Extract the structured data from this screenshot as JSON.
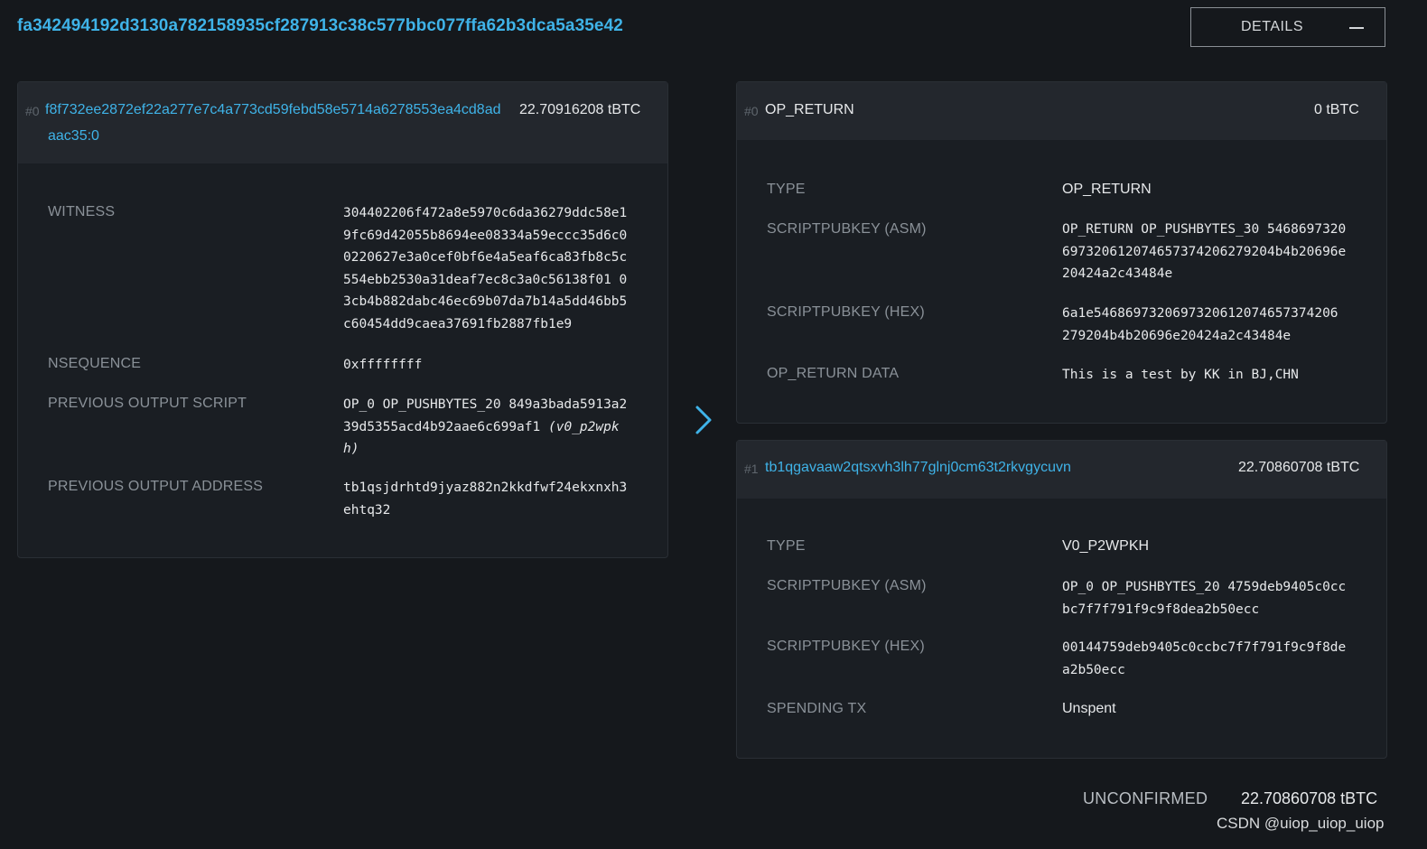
{
  "tx": {
    "txid": "fa342494192d3130a782158935cf287913c38c577bbc077ffa62b3dca5a35e42",
    "details_label": "DETAILS"
  },
  "inputs": [
    {
      "index": "#0",
      "prev_out_line1": "f8f732ee2872ef22a277e7c4a773cd59febd58e5714a6278553ea4cd8ad",
      "prev_out_line2": "aac35:0",
      "amount": "22.70916208 tBTC",
      "fields": {
        "witness_label": "WITNESS",
        "witness_lines": [
          "304402206f472a8e5970c6da36279ddc58e1",
          "9fc69d42055b8694ee08334a59eccc35d6c0",
          "0220627e3a0cef0bf6e4a5eaf6ca83fb8c5c",
          "554ebb2530a31deaf7ec8c3a0c56138f01 0",
          "3cb4b882dabc46ec69b07da7b14a5dd46bb5",
          "c60454dd9caea37691fb2887fb1e9"
        ],
        "nsequence_label": "NSEQUENCE",
        "nsequence": "0xffffffff",
        "prev_script_label": "PREVIOUS OUTPUT SCRIPT",
        "prev_script_line1": "OP_0 OP_PUSHBYTES_20 849a3bada5913a2",
        "prev_script_line2": "39d5355acd4b92aae6c699af1",
        "prev_script_type_a": "(v0_p2wpk",
        "prev_script_type_b": "h)",
        "prev_addr_label": "PREVIOUS OUTPUT ADDRESS",
        "prev_addr_line1": "tb1qsjdrhtd9jyaz882n2kkdfwf24ekxnxh3",
        "prev_addr_line2": "ehtq32"
      }
    }
  ],
  "outputs": [
    {
      "index": "#0",
      "title": "OP_RETURN",
      "amount": "0 tBTC",
      "type_label": "TYPE",
      "type": "OP_RETURN",
      "asm_label": "SCRIPTPUBKEY (ASM)",
      "asm_lines": [
        "OP_RETURN OP_PUSHBYTES_30 5468697320",
        "697320612074657374206279204b4b20696e",
        "20424a2c43484e"
      ],
      "hex_label": "SCRIPTPUBKEY (HEX)",
      "hex_lines": [
        "6a1e5468697320697320612074657374206",
        "279204b4b20696e20424a2c43484e"
      ],
      "data_label": "OP_RETURN DATA",
      "data": "This is a test by KK in BJ,CHN"
    },
    {
      "index": "#1",
      "title": "tb1qgavaaw2qtsxvh3lh77glnj0cm63t2rkvgycuvn",
      "amount": "22.70860708 tBTC",
      "type_label": "TYPE",
      "type": "V0_P2WPKH",
      "asm_label": "SCRIPTPUBKEY (ASM)",
      "asm_lines": [
        "OP_0 OP_PUSHBYTES_20 4759deb9405c0cc",
        "bc7f7f791f9c9f8dea2b50ecc"
      ],
      "hex_label": "SCRIPTPUBKEY (HEX)",
      "hex_lines": [
        "00144759deb9405c0ccbc7f7f791f9c9f8de",
        "a2b50ecc"
      ],
      "spending_label": "SPENDING TX",
      "spending": "Unspent"
    }
  ],
  "footer": {
    "status": "UNCONFIRMED",
    "total": "22.70860708 tBTC"
  },
  "watermark": "CSDN @uiop_uiop_uiop",
  "colors": {
    "background": "#15181c",
    "card": "#1a1e23",
    "card_header": "#23272d",
    "link": "#3fb3e8",
    "label": "#8a9198"
  }
}
